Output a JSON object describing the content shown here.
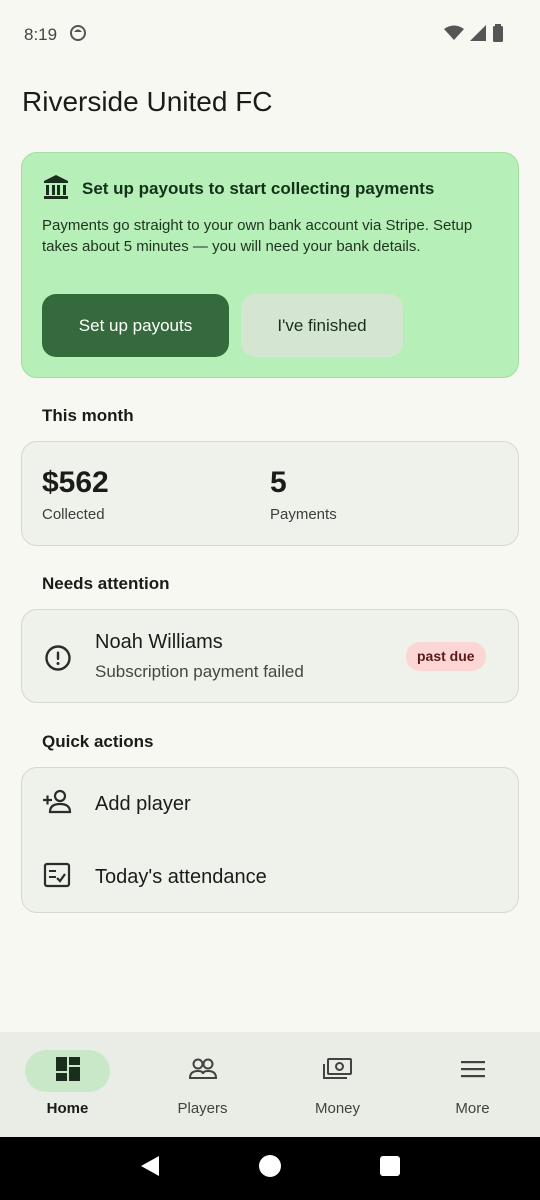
{
  "status_bar": {
    "time": "8:19"
  },
  "page": {
    "title": "Riverside United FC"
  },
  "payout_banner": {
    "title": "Set up payouts to start collecting payments",
    "description": "Payments go straight to your own bank account via Stripe. Setup takes about 5 minutes — you will need your bank details.",
    "primary_label": "Set up payouts",
    "secondary_label": "I've finished"
  },
  "this_month": {
    "heading": "This month",
    "collected_value": "$562",
    "collected_label": "Collected",
    "payments_value": "5",
    "payments_label": "Payments"
  },
  "attention": {
    "heading": "Needs attention",
    "items": [
      {
        "name": "Noah Williams",
        "detail": "Subscription payment failed",
        "badge": "past due",
        "icon": "alert-circle-icon"
      }
    ]
  },
  "quick_actions": {
    "heading": "Quick actions",
    "items": [
      {
        "label": "Add player",
        "icon": "person-add-icon"
      },
      {
        "label": "Today's attendance",
        "icon": "checklist-icon"
      }
    ]
  },
  "bottom_nav": {
    "items": [
      {
        "label": "Home",
        "icon": "dashboard-icon",
        "active": true
      },
      {
        "label": "Players",
        "icon": "group-icon",
        "active": false
      },
      {
        "label": "Money",
        "icon": "payments-icon",
        "active": false
      },
      {
        "label": "More",
        "icon": "menu-icon",
        "active": false
      }
    ]
  },
  "colors": {
    "banner_bg": "#b6efb7",
    "primary_button": "#356a3c",
    "badge_bg": "#fbd6d4",
    "nav_active_pill": "#c9e8c7"
  }
}
